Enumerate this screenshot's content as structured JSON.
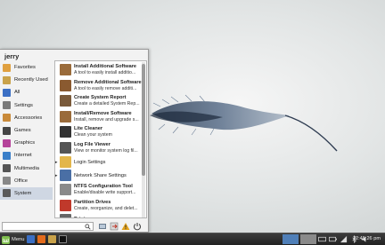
{
  "menu": {
    "username": "jerry",
    "categories": [
      {
        "label": "Favorites",
        "color": "#e0a040"
      },
      {
        "label": "Recently Used",
        "color": "#c9a24a"
      },
      {
        "label": "All",
        "color": "#3b6fc4"
      },
      {
        "label": "Settings",
        "color": "#7a7a7a"
      },
      {
        "label": "Accessories",
        "color": "#c98a3a"
      },
      {
        "label": "Games",
        "color": "#444444"
      },
      {
        "label": "Graphics",
        "color": "#b5439a"
      },
      {
        "label": "Internet",
        "color": "#3a7fc9"
      },
      {
        "label": "Multimedia",
        "color": "#555555"
      },
      {
        "label": "Office",
        "color": "#888888"
      },
      {
        "label": "System",
        "color": "#5a5a5a"
      }
    ],
    "active_category": "System",
    "apps": [
      {
        "title": "Install Additional Software",
        "desc": "A tool to easily install additio...",
        "icon": "package-icon",
        "color": "#9a6b3a"
      },
      {
        "title": "Remove Additional Software",
        "desc": "A tool to easily remove additi...",
        "icon": "package-icon",
        "color": "#8a5a30"
      },
      {
        "title": "Create System Report",
        "desc": "Create a detailed System Rep...",
        "icon": "report-icon",
        "color": "#7a5a3a"
      },
      {
        "title": "Install/Remove Software",
        "desc": "Install, remove and upgrade s...",
        "icon": "package-icon",
        "color": "#9a6b3a"
      },
      {
        "title": "Lite Cleaner",
        "desc": "Clean your system",
        "icon": "cleaner-icon",
        "color": "#333333"
      },
      {
        "title": "Log File Viewer",
        "desc": "View or monitor system log fil...",
        "icon": "log-icon",
        "color": "#555555"
      },
      {
        "title": "Login Settings",
        "desc": "",
        "icon": "folder-icon",
        "color": "#e3b64a",
        "submenu": true
      },
      {
        "title": "Network Share Settings",
        "desc": "",
        "icon": "network-icon",
        "color": "#4a6fa5",
        "submenu": true
      },
      {
        "title": "NTFS Configuration Tool",
        "desc": "Enable/disable write support...",
        "icon": "disk-icon",
        "color": "#8a8a8a"
      },
      {
        "title": "Partition Drives",
        "desc": "Create, reorganize, and delet...",
        "icon": "partition-icon",
        "color": "#c0392b"
      },
      {
        "title": "Printers",
        "desc": "",
        "icon": "printer-icon",
        "color": "#666666"
      }
    ],
    "search": {
      "placeholder": "",
      "value": ""
    }
  },
  "taskbar": {
    "menu_label": "Menu",
    "clock": "12:45:26 pm",
    "workspace_colors": [
      "#4f7fb8",
      "#8a8a8a"
    ]
  }
}
